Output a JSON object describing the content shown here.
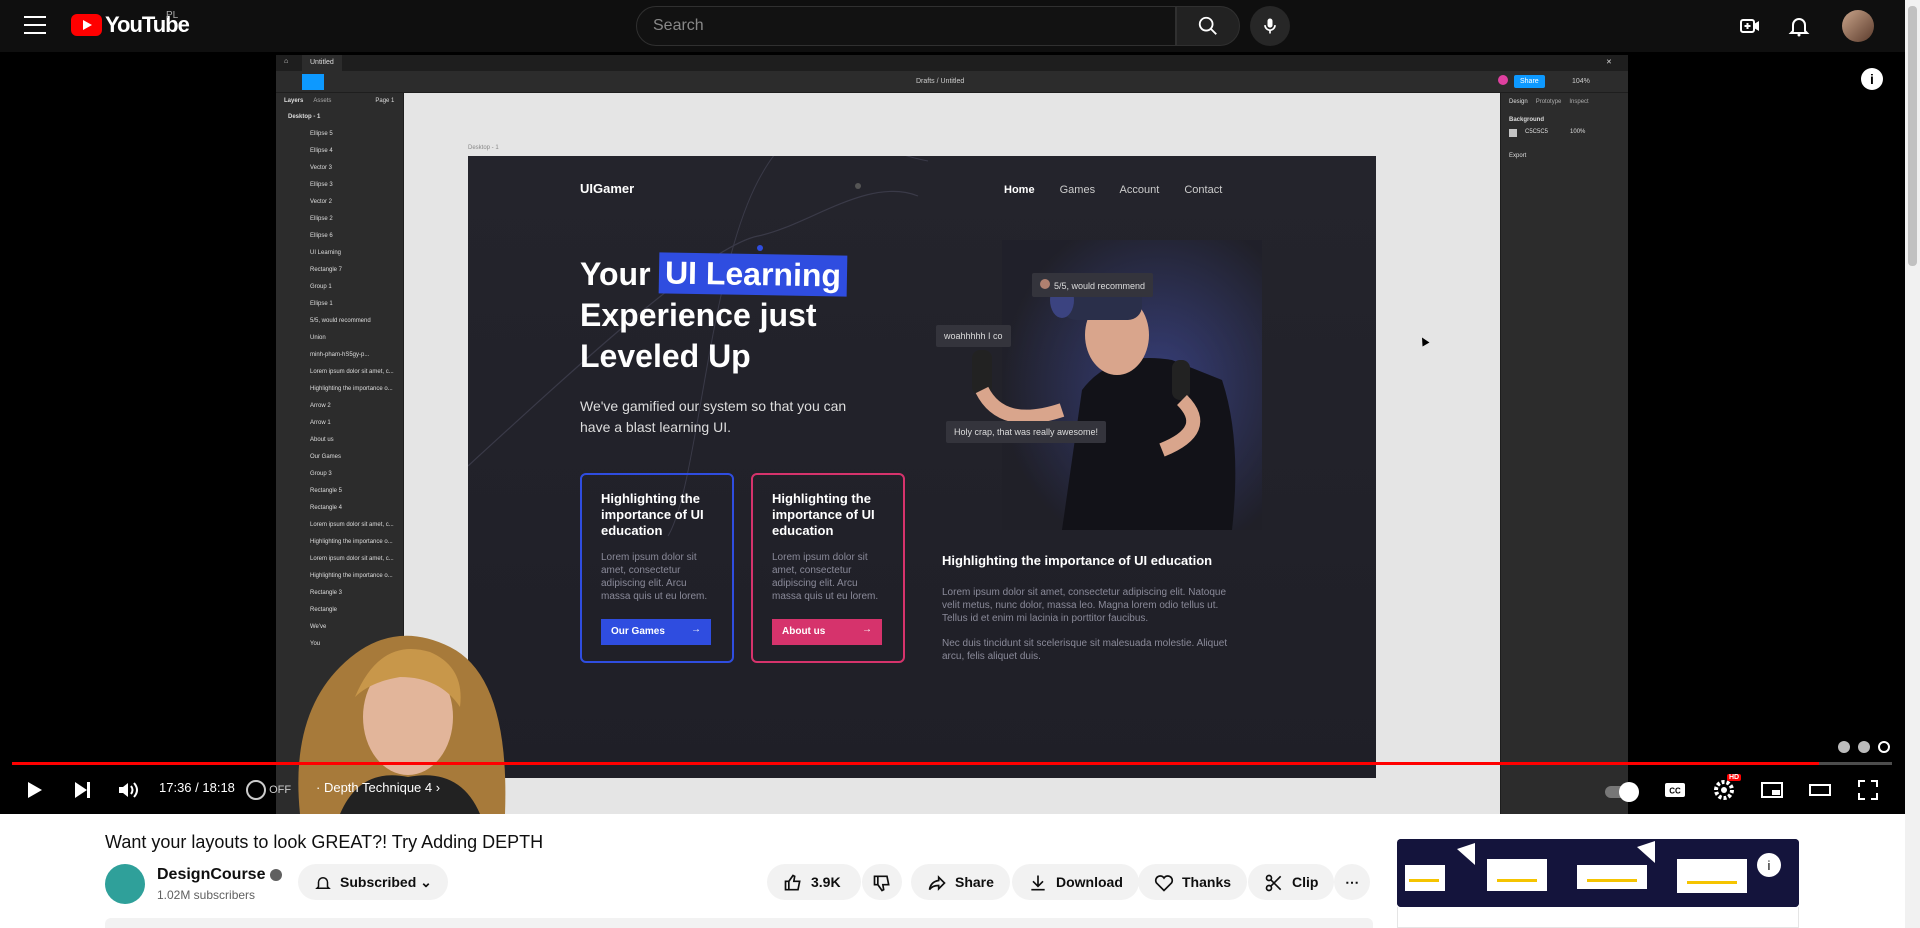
{
  "header": {
    "logo_text": "YouTube",
    "country": "PL",
    "search_placeholder": "Search"
  },
  "figma": {
    "tab": "Untitled",
    "breadcrumb": "Drafts / Untitled",
    "share": "Share",
    "zoom": "104%",
    "panel_tabs": [
      "Layers",
      "Assets"
    ],
    "page": "Page 1",
    "frame": "Desktop - 1",
    "frame_label": "Desktop - 1",
    "layers": [
      "Ellipse 5",
      "Ellipse 4",
      "Vector 3",
      "Ellipse 3",
      "Vector 2",
      "Ellipse 2",
      "Ellipse 6",
      "UI Learning",
      "Rectangle 7",
      "Group 1",
      "Ellipse 1",
      "5/5, would recommend",
      "Union",
      "minh-pham-hS5gy-p...",
      "Lorem ipsum dolor sit amet, c...",
      "Highlighting the importance o...",
      "Arrow 2",
      "Arrow 1",
      "About us",
      "Our Games",
      "Group 3",
      "Rectangle 5",
      "Rectangle 4",
      "Lorem ipsum dolor sit amet, c...",
      "Highlighting the importance o...",
      "Lorem ipsum dolor sit amet, c...",
      "Highlighting the importance o...",
      "Rectangle 3",
      "Rectangle",
      "We've",
      "You"
    ],
    "right_tabs": [
      "Design",
      "Prototype",
      "Inspect"
    ],
    "background_label": "Background",
    "background_hex": "C5C5C5",
    "background_opacity": "100%",
    "export_label": "Export"
  },
  "site": {
    "logo": "UIGamer",
    "nav": [
      "Home",
      "Games",
      "Account",
      "Contact"
    ],
    "hero_word1": "Your",
    "hero_highlight": "UI Learning",
    "hero_rest": "Experience just Leveled Up",
    "subtitle": "We've gamified our system so that you can have a blast learning UI.",
    "card1": {
      "title": "Highlighting the importance of UI education",
      "body": "Lorem ipsum dolor sit amet, consectetur adipiscing elit. Arcu massa quis ut eu lorem.",
      "button": "Our Games"
    },
    "card2": {
      "title": "Highlighting the importance of UI education",
      "body": "Lorem ipsum dolor sit amet, consectetur adipiscing elit. Arcu massa quis ut eu lorem.",
      "button": "About us"
    },
    "bubble1": "5/5, would recommend",
    "bubble2": "woahhhhh I co",
    "bubble3": "Holy crap, that was really awesome!",
    "heading2": "Highlighting the importance of UI education",
    "para1": "Lorem ipsum dolor sit amet, consectetur adipiscing elit. Natoque velit metus, nunc dolor, massa leo. Magna lorem odio tellus ut. Tellus id et enim mi lacinia in porttitor faucibus.",
    "para2": "Nec duis tincidunt sit scelerisque sit malesuada molestie. Aliquet arcu, felis aliquet duis."
  },
  "player": {
    "time": "17:36 / 18:18",
    "progress": 0.961,
    "chapter": "Depth Technique 4",
    "autoplay_label": "OFF",
    "hd_badge": "HD"
  },
  "video": {
    "title": "Want your layouts to look GREAT?! Try Adding DEPTH",
    "channel": "DesignCourse",
    "subscribers": "1.02M subscribers",
    "subscribed": "Subscribed",
    "likes": "3.9K",
    "share": "Share",
    "download": "Download",
    "thanks": "Thanks",
    "clip": "Clip"
  },
  "colors": {
    "accent_red": "#ff0000",
    "blue": "#2f4de0",
    "pink": "#d6336c"
  }
}
